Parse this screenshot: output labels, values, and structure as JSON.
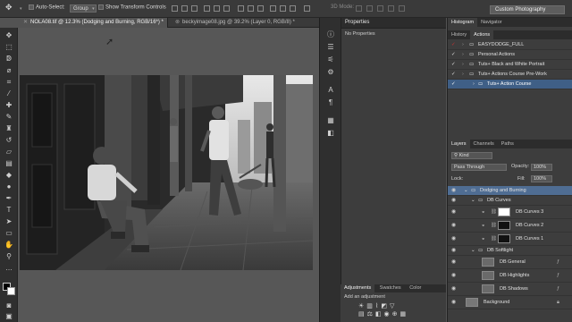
{
  "options_bar": {
    "auto_select_label": "Auto-Select:",
    "auto_select_value": "Group",
    "transform_controls_label": "Show Transform Controls",
    "mode_3d_label": "3D Mode:",
    "workspace": "Custom Photography"
  },
  "tabs": [
    {
      "label": "NOLA08.tif @ 12.3% (Dodging and Burning, RGB/16*) *"
    },
    {
      "label": "beckyimage08.jpg @ 39.2% (Layer 0, RGB/8) *"
    }
  ],
  "properties": {
    "title": "Properties",
    "status": "No Properties"
  },
  "adjustments": {
    "tabs": [
      "Adjustments",
      "Swatches",
      "Color"
    ],
    "subtitle": "Add an adjustment"
  },
  "history_panel": {
    "tabs": [
      "History",
      "Actions"
    ],
    "top_tabs": [
      "Histogram",
      "Navigator"
    ],
    "actions": [
      {
        "label": "EASYDODGE_FULL",
        "level": 0
      },
      {
        "label": "Personal Actions",
        "level": 0
      },
      {
        "label": "Tuts+ Black and White Portrait",
        "level": 0
      },
      {
        "label": "Tuts+ Actions Course Pre-Work",
        "level": 0
      },
      {
        "label": "Tuts+ Action Course",
        "level": 1
      }
    ]
  },
  "layers_panel": {
    "tabs": [
      "Layers",
      "Channels",
      "Paths"
    ],
    "kind_label": "Kind",
    "blend_mode": "Pass Through",
    "opacity_label": "Opacity:",
    "opacity_value": "100%",
    "lock_label": "Lock:",
    "fill_label": "Fill:",
    "fill_value": "100%",
    "layers": [
      {
        "name": "Dodging and Burning",
        "type": "group",
        "indent": 0
      },
      {
        "name": "DB Curves",
        "type": "group",
        "indent": 1
      },
      {
        "name": "DB Curves 3",
        "type": "curves",
        "indent": 2
      },
      {
        "name": "DB Curves 2",
        "type": "curves",
        "indent": 2
      },
      {
        "name": "DB Curves 1",
        "type": "curves",
        "indent": 2
      },
      {
        "name": "DB Softlight",
        "type": "group",
        "indent": 1
      },
      {
        "name": "DB General",
        "type": "layer",
        "indent": 2
      },
      {
        "name": "DB Highlights",
        "type": "layer",
        "indent": 2
      },
      {
        "name": "DB Shadows",
        "type": "layer",
        "indent": 2
      },
      {
        "name": "Background",
        "type": "layer",
        "indent": 0
      }
    ]
  }
}
